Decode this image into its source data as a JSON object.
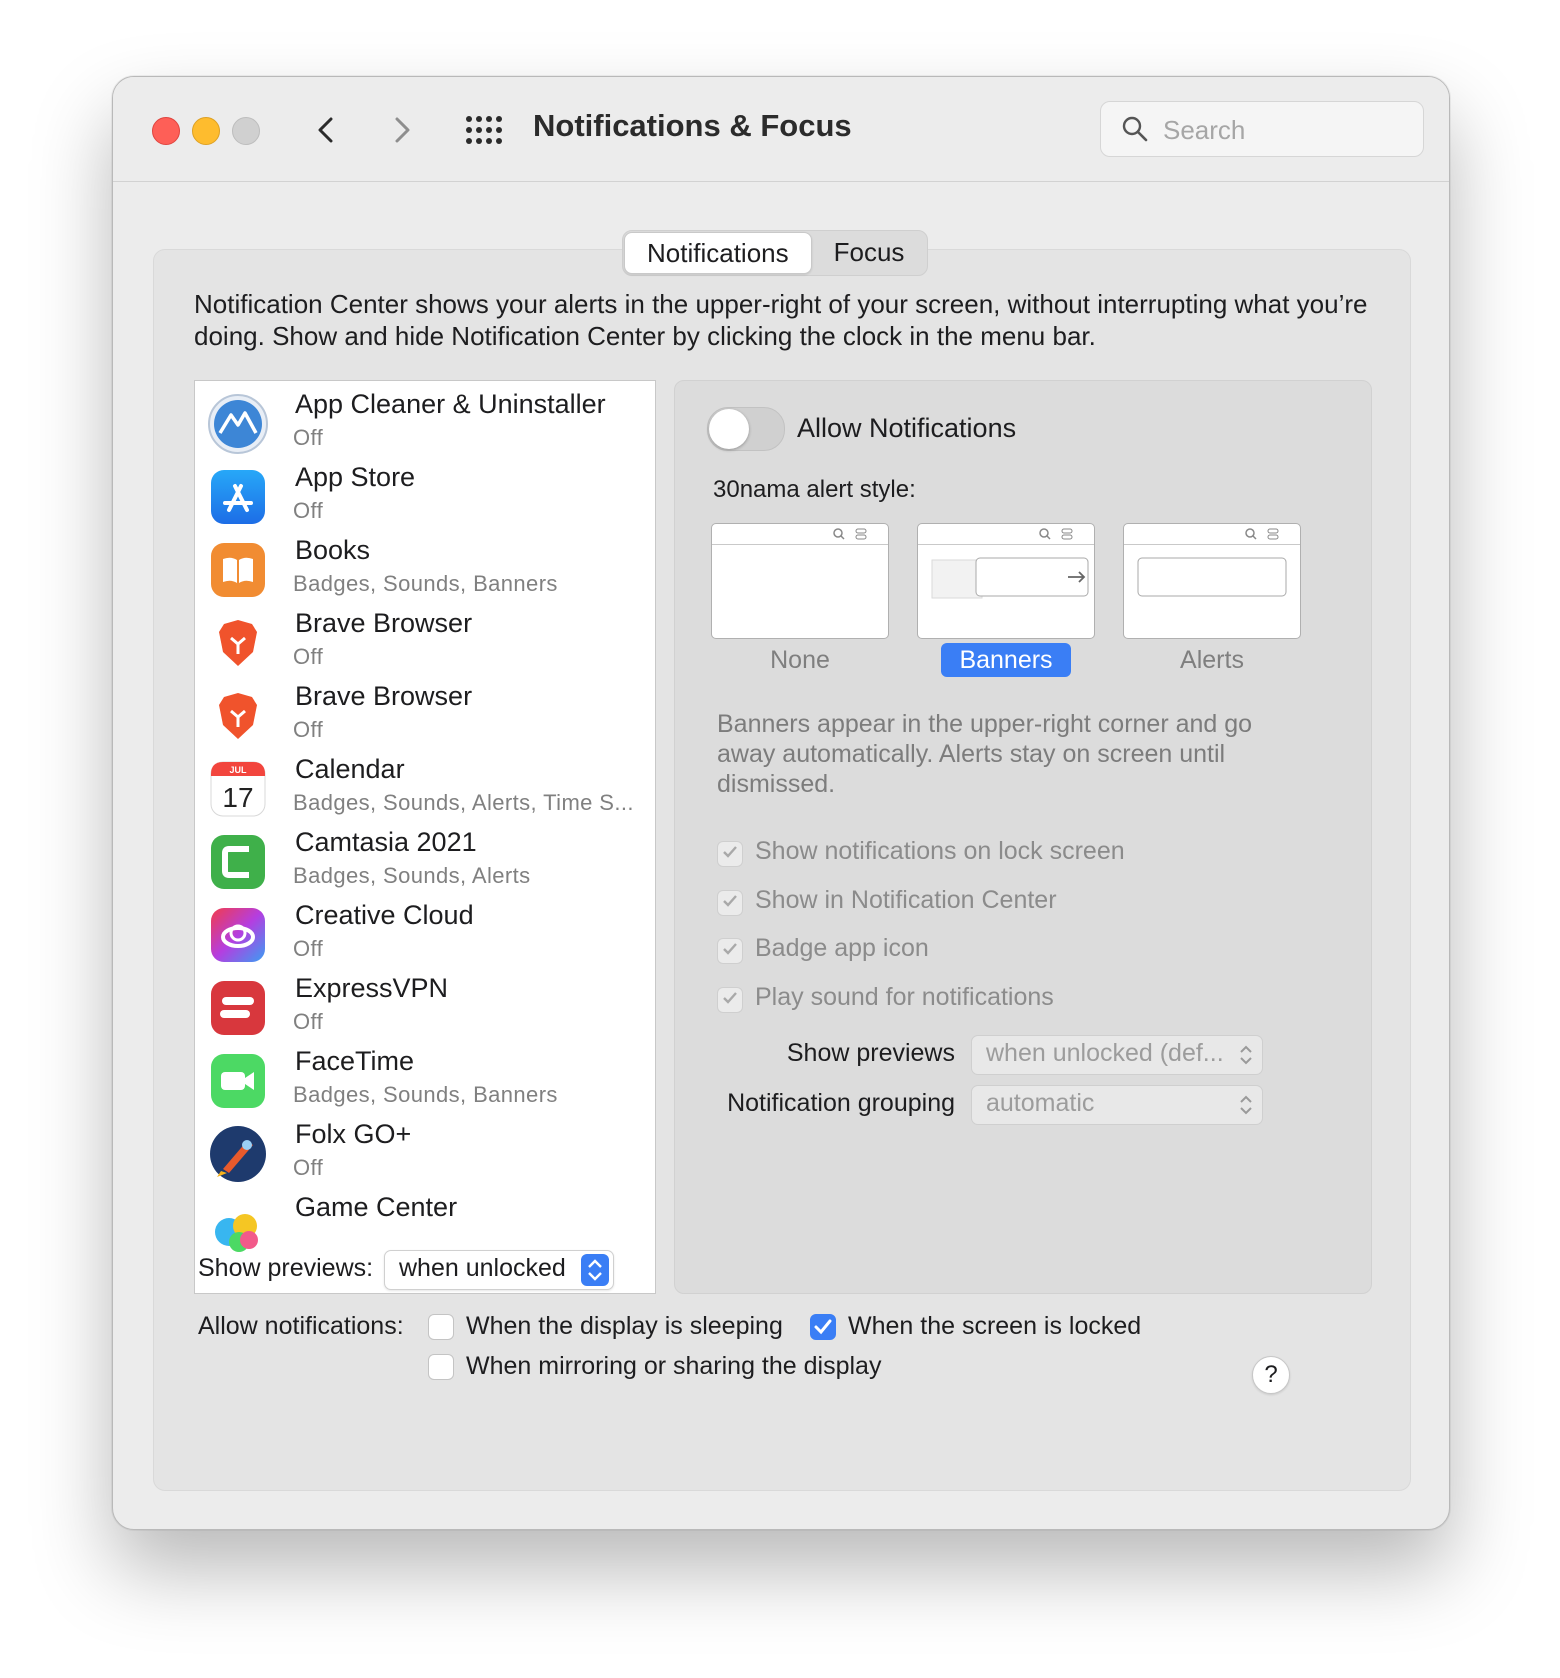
{
  "window": {
    "title": "Notifications & Focus",
    "search_placeholder": "Search"
  },
  "tabs": [
    {
      "label": "Notifications",
      "active": true
    },
    {
      "label": "Focus",
      "active": false
    }
  ],
  "description": "Notification Center shows your alerts in the upper-right of your screen, without interrupting what you’re doing. Show and hide Notification Center by clicking the clock in the menu bar.",
  "apps": [
    {
      "name": "App Cleaner & Uninstaller",
      "status": "Off",
      "icon": "app-cleaner-icon"
    },
    {
      "name": "App Store",
      "status": "Off",
      "icon": "app-store-icon"
    },
    {
      "name": "Books",
      "status": "Badges, Sounds, Banners",
      "icon": "books-icon"
    },
    {
      "name": "Brave Browser",
      "status": "Off",
      "icon": "brave-icon"
    },
    {
      "name": "Brave Browser",
      "status": "Off",
      "icon": "brave-icon"
    },
    {
      "name": "Calendar",
      "status": "Badges, Sounds, Alerts, Time S...",
      "icon": "calendar-icon",
      "icon_month": "JUL",
      "icon_day": "17"
    },
    {
      "name": "Camtasia 2021",
      "status": "Badges, Sounds, Alerts",
      "icon": "camtasia-icon"
    },
    {
      "name": "Creative Cloud",
      "status": "Off",
      "icon": "creative-cloud-icon"
    },
    {
      "name": "ExpressVPN",
      "status": "Off",
      "icon": "expressvpn-icon"
    },
    {
      "name": "FaceTime",
      "status": "Badges, Sounds, Banners",
      "icon": "facetime-icon"
    },
    {
      "name": "Folx GO+",
      "status": "Off",
      "icon": "folx-icon"
    },
    {
      "name": "Game Center",
      "status": "",
      "icon": "game-center-icon"
    }
  ],
  "settings": {
    "allow_notifications_label": "Allow Notifications",
    "allow_notifications_on": false,
    "alert_style_label": "30nama alert style:",
    "styles": [
      {
        "label": "None",
        "selected": false
      },
      {
        "label": "Banners",
        "selected": true
      },
      {
        "label": "Alerts",
        "selected": false
      }
    ],
    "style_description": "Banners appear in the upper-right corner and go away automatically. Alerts stay on screen until dismissed.",
    "checkboxes": [
      {
        "label": "Show notifications on lock screen",
        "checked": true
      },
      {
        "label": "Show in Notification Center",
        "checked": true
      },
      {
        "label": "Badge app icon",
        "checked": true
      },
      {
        "label": "Play sound for notifications",
        "checked": true
      }
    ],
    "show_previews_label": "Show previews",
    "show_previews_value": "when unlocked (def...",
    "grouping_label": "Notification grouping",
    "grouping_value": "automatic"
  },
  "bottom": {
    "show_previews_label": "Show previews:",
    "show_previews_value": "when unlocked",
    "allow_label": "Allow notifications:",
    "options": [
      {
        "label": "When the display is sleeping",
        "checked": false
      },
      {
        "label": "When the screen is locked",
        "checked": true
      },
      {
        "label": "When mirroring or sharing the display",
        "checked": false
      }
    ],
    "help_label": "?"
  },
  "colors": {
    "accent": "#3a7ef5",
    "close": "#fe5f57",
    "minimize": "#febc2e"
  }
}
